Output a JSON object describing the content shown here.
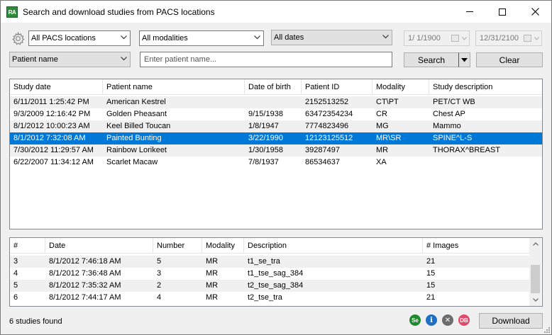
{
  "window": {
    "title": "Search and download studies from PACS locations",
    "app_icon_text": "RA"
  },
  "filters": {
    "location": "All PACS locations",
    "modality": "All modalities",
    "dates": "All dates",
    "date_from": "1/  1/1900",
    "date_to": "12/31/2100",
    "search_field": "Patient name",
    "search_placeholder": "Enter patient name...",
    "search_label": "Search",
    "clear_label": "Clear"
  },
  "studies": {
    "columns": [
      "Study date",
      "Patient name",
      "Date of birth",
      "Patient ID",
      "Modality",
      "Study description"
    ],
    "selected_index": 3,
    "rows": [
      [
        "6/11/2011 1:25:42 PM",
        "American Kestrel",
        "",
        "2152513252",
        "CT\\PT",
        "PET/CT WB"
      ],
      [
        "9/3/2009 12:16:42 PM",
        "Golden Pheasant",
        "9/15/1938",
        "63472354234",
        "CR",
        "Chest AP"
      ],
      [
        "8/1/2012 10:00:23 AM",
        "Keel Billed Toucan",
        "1/8/1947",
        "7774823496",
        "MG",
        "Mammo"
      ],
      [
        "8/1/2012 7:32:08 AM",
        "Painted Bunting",
        "3/22/1990",
        "12123125512",
        "MR\\SR",
        "SPINE^L-S"
      ],
      [
        "7/30/2012 11:29:57 AM",
        "Rainbow Lorikeet",
        "1/30/1958",
        "39287497",
        "MR",
        "THORAX^BREAST"
      ],
      [
        "6/22/2007 11:34:12 AM",
        "Scarlet Macaw",
        "7/8/1937",
        "86534637",
        "XA",
        ""
      ]
    ]
  },
  "series": {
    "columns": [
      "#",
      "Date",
      "Number",
      "Modality",
      "Description",
      "# Images"
    ],
    "rows": [
      [
        "3",
        "8/1/2012 7:46:18 AM",
        "5",
        "MR",
        "t1_se_tra",
        "21"
      ],
      [
        "4",
        "8/1/2012 7:36:48 AM",
        "3",
        "MR",
        "t1_tse_sag_384",
        "15"
      ],
      [
        "5",
        "8/1/2012 7:35:32 AM",
        "2",
        "MR",
        "t2_tse_sag_384",
        "15"
      ],
      [
        "6",
        "8/1/2012 7:44:17 AM",
        "4",
        "MR",
        "t2_tse_tra",
        "21"
      ]
    ]
  },
  "footer": {
    "status": "6 studies found",
    "badge_se": "Se",
    "badge_info": "i",
    "badge_x": "✕",
    "badge_db": "DB",
    "download_label": "Download"
  },
  "colors": {
    "selection": "#0078d7",
    "badge_se": "#1e8a2e",
    "badge_info": "#1f6fc5",
    "badge_x": "#6d6d6d",
    "badge_db": "#e24a6b"
  },
  "icons": {
    "settings": "gear-icon",
    "dropdown": "chevron-down-icon",
    "calendar": "calendar-icon",
    "minimize": "minimize-icon",
    "maximize": "maximize-icon",
    "close": "close-icon"
  }
}
